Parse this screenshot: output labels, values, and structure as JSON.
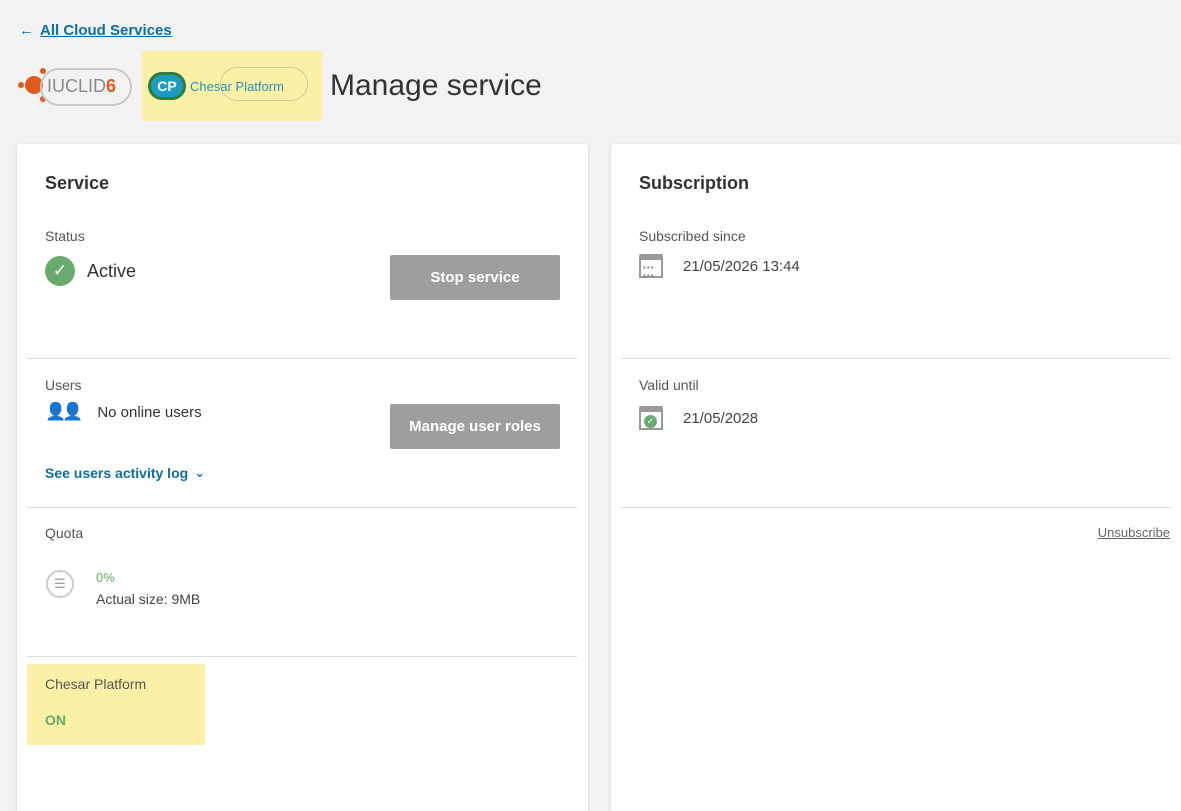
{
  "nav": {
    "back_label": "All Cloud Services"
  },
  "header": {
    "iuclid_logo_text": "IUCLID",
    "iuclid_logo_version": "6",
    "cp_logo_badge": "CP",
    "cp_logo_text": "Chesar Platform",
    "title": "Manage service"
  },
  "service": {
    "title": "Service",
    "status_label": "Status",
    "status_value": "Active",
    "stop_button": "Stop service",
    "users_label": "Users",
    "users_value": "No online users",
    "manage_roles_button": "Manage user roles",
    "activity_link": "See users activity log",
    "quota_label": "Quota",
    "quota_percent": "0%",
    "quota_size": "Actual size: 9MB",
    "app_label": "Chesar Platform",
    "app_state": "ON"
  },
  "subscription": {
    "title": "Subscription",
    "since_label": "Subscribed since",
    "since_value": "21/05/2026 13:44",
    "valid_label": "Valid until",
    "valid_value": "21/05/2028",
    "unsubscribe_link": "Unsubscribe"
  },
  "colors": {
    "link": "#0b6fa8",
    "active_green": "#6aaa6f",
    "highlight": "#fbf1a6",
    "button_gray": "#9e9e9e"
  }
}
